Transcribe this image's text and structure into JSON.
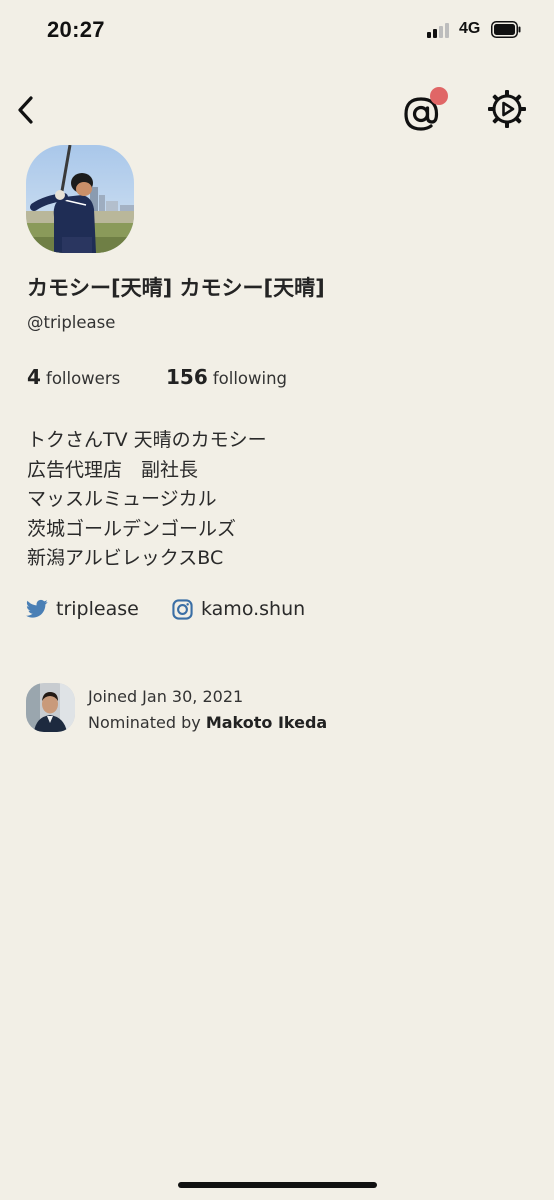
{
  "status_bar": {
    "time": "20:27",
    "network": "4G",
    "signal_bars_active": 2,
    "signal_bars_total": 4
  },
  "nav": {
    "back_icon": "chevron-left-icon",
    "mention_icon": "at-sign-icon",
    "settings_icon": "gear-icon",
    "notification_dot_color": "#e06666"
  },
  "profile": {
    "name": "カモシー[天晴] カモシー[天晴]",
    "handle": "@triplease",
    "followers_count": "4",
    "followers_label": "followers",
    "following_count": "156",
    "following_label": "following",
    "bio_lines": [
      "トクさんTV 天晴のカモシー",
      "広告代理店　副社長",
      "マッスルミュージカル",
      "茨城ゴールデンゴールズ",
      "新潟アルビレックスBC"
    ],
    "twitter": "triplease",
    "instagram": "kamo.shun"
  },
  "joined": {
    "date_text": "Joined Jan 30, 2021",
    "nominated_prefix": "Nominated by ",
    "nominator_name": "Makoto Ikeda"
  },
  "colors": {
    "background": "#f2efe6",
    "twitter_icon": "#4a7fb5",
    "instagram_icon": "#3a6ea5"
  }
}
